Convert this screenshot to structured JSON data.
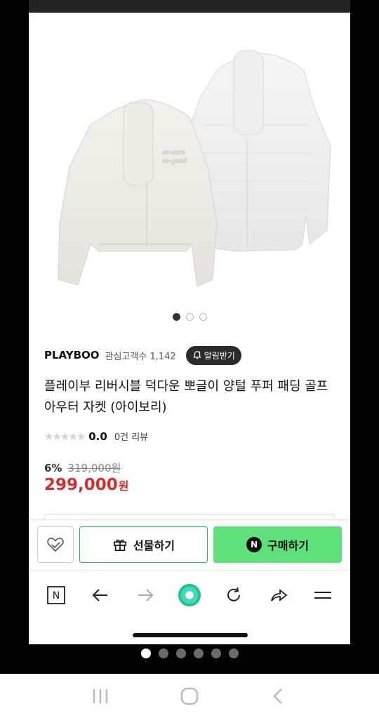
{
  "product": {
    "brand": "PLAYBOO",
    "fans_label": "관심고객수 1,142",
    "alarm_label": "알림받기",
    "title": "플레이부 리버시블 덕다운 뽀글이 양털 푸퍼 패딩 골프아우터 자켓 (아이보리)",
    "rating": "0.0",
    "review_count": "0건 리뷰",
    "discount": "6%",
    "original_price": "319,000원",
    "price": "299,000",
    "price_unit": "원",
    "image_dots": 3,
    "active_image": 0
  },
  "actions": {
    "gift_label": "선물하기",
    "buy_label": "구매하기",
    "buy_badge": "N"
  },
  "browser": {
    "home_badge": "N"
  },
  "pager": {
    "count": 6,
    "active": 0
  },
  "colors": {
    "price_red": "#d32f2f",
    "buy_green": "#5ee07a",
    "gift_border": "#23b45a"
  }
}
